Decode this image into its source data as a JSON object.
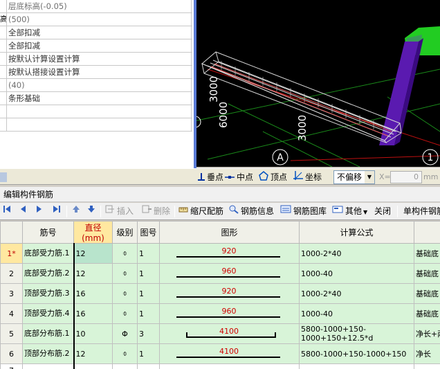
{
  "viewport": {
    "dim_labels": [
      "3000",
      "6000",
      "3000"
    ],
    "axis_labels": [
      "A",
      "1"
    ]
  },
  "properties": {
    "rows": [
      {
        "stub": "",
        "value": "层底标高(-0.05)",
        "gray": true
      },
      {
        "stub": "高",
        "value": "(500)",
        "gray": true
      },
      {
        "stub": "",
        "value": "全部扣减",
        "gray": false
      },
      {
        "stub": "",
        "value": "全部扣减",
        "gray": false
      },
      {
        "stub": "",
        "value": "按默认计算设置计算",
        "gray": false
      },
      {
        "stub": "",
        "value": "按默认搭接设置计算",
        "gray": false
      },
      {
        "stub": "",
        "value": "(40)",
        "gray": true
      },
      {
        "stub": "",
        "value": "条形基础",
        "gray": false
      },
      {
        "stub": "",
        "value": "",
        "gray": false
      },
      {
        "stub": "",
        "value": "",
        "gray": false
      }
    ]
  },
  "snapbar": {
    "items": [
      "垂点",
      "中点",
      "顶点",
      "坐标"
    ],
    "offset_select": "不偏移",
    "x_label": "X=",
    "x_value": "0",
    "unit": "mm"
  },
  "editor": {
    "title": "编辑构件钢筋"
  },
  "toolbar": {
    "insert": "插入",
    "delete": "删除",
    "scale_rebar": "缩尺配筋",
    "rebar_info": "钢筋信息",
    "rebar_lib": "钢筋图库",
    "other": "其他",
    "close": "关闭",
    "single_total": "单构件钢筋"
  },
  "grid": {
    "headers": [
      "",
      "筋号",
      "直径(mm)",
      "级别",
      "图号",
      "图形",
      "计算公式",
      ""
    ],
    "rows": [
      {
        "idx": "1*",
        "name": "底部受力筋.1",
        "dia": "12",
        "grade": "⌽",
        "fig": "1",
        "shape_val": "920",
        "hooks": false,
        "formula": "1000-2*40",
        "desc": "基础底"
      },
      {
        "idx": "2",
        "name": "底部受力筋.2",
        "dia": "12",
        "grade": "⌽",
        "fig": "1",
        "shape_val": "960",
        "hooks": false,
        "formula": "1000-40",
        "desc": "基础底"
      },
      {
        "idx": "3",
        "name": "顶部受力筋.3",
        "dia": "16",
        "grade": "⌽",
        "fig": "1",
        "shape_val": "920",
        "hooks": false,
        "formula": "1000-2*40",
        "desc": "基础底"
      },
      {
        "idx": "4",
        "name": "顶部受力筋.4",
        "dia": "16",
        "grade": "⌽",
        "fig": "1",
        "shape_val": "960",
        "hooks": false,
        "formula": "1000-40",
        "desc": "基础底"
      },
      {
        "idx": "5",
        "name": "底部分布筋.1",
        "dia": "10",
        "grade": "Φ",
        "fig": "3",
        "shape_val": "4100",
        "hooks": true,
        "formula": "5800-1000+150-1000+150+12.5*d",
        "desc": "净长+两"
      },
      {
        "idx": "6",
        "name": "顶部分布筋.2",
        "dia": "12",
        "grade": "⌽",
        "fig": "1",
        "shape_val": "4100",
        "hooks": false,
        "formula": "5800-1000+150-1000+150",
        "desc": "净长"
      },
      {
        "idx": "7",
        "name": "",
        "dia": "",
        "grade": "",
        "fig": "",
        "shape_val": "",
        "hooks": false,
        "formula": "",
        "desc": ""
      }
    ]
  },
  "colors": {
    "grid_row": "#d8f4d8",
    "header_highlight": "#ffe8a0",
    "shape_text": "#d00000",
    "panel_border": "#5a7bd6"
  }
}
